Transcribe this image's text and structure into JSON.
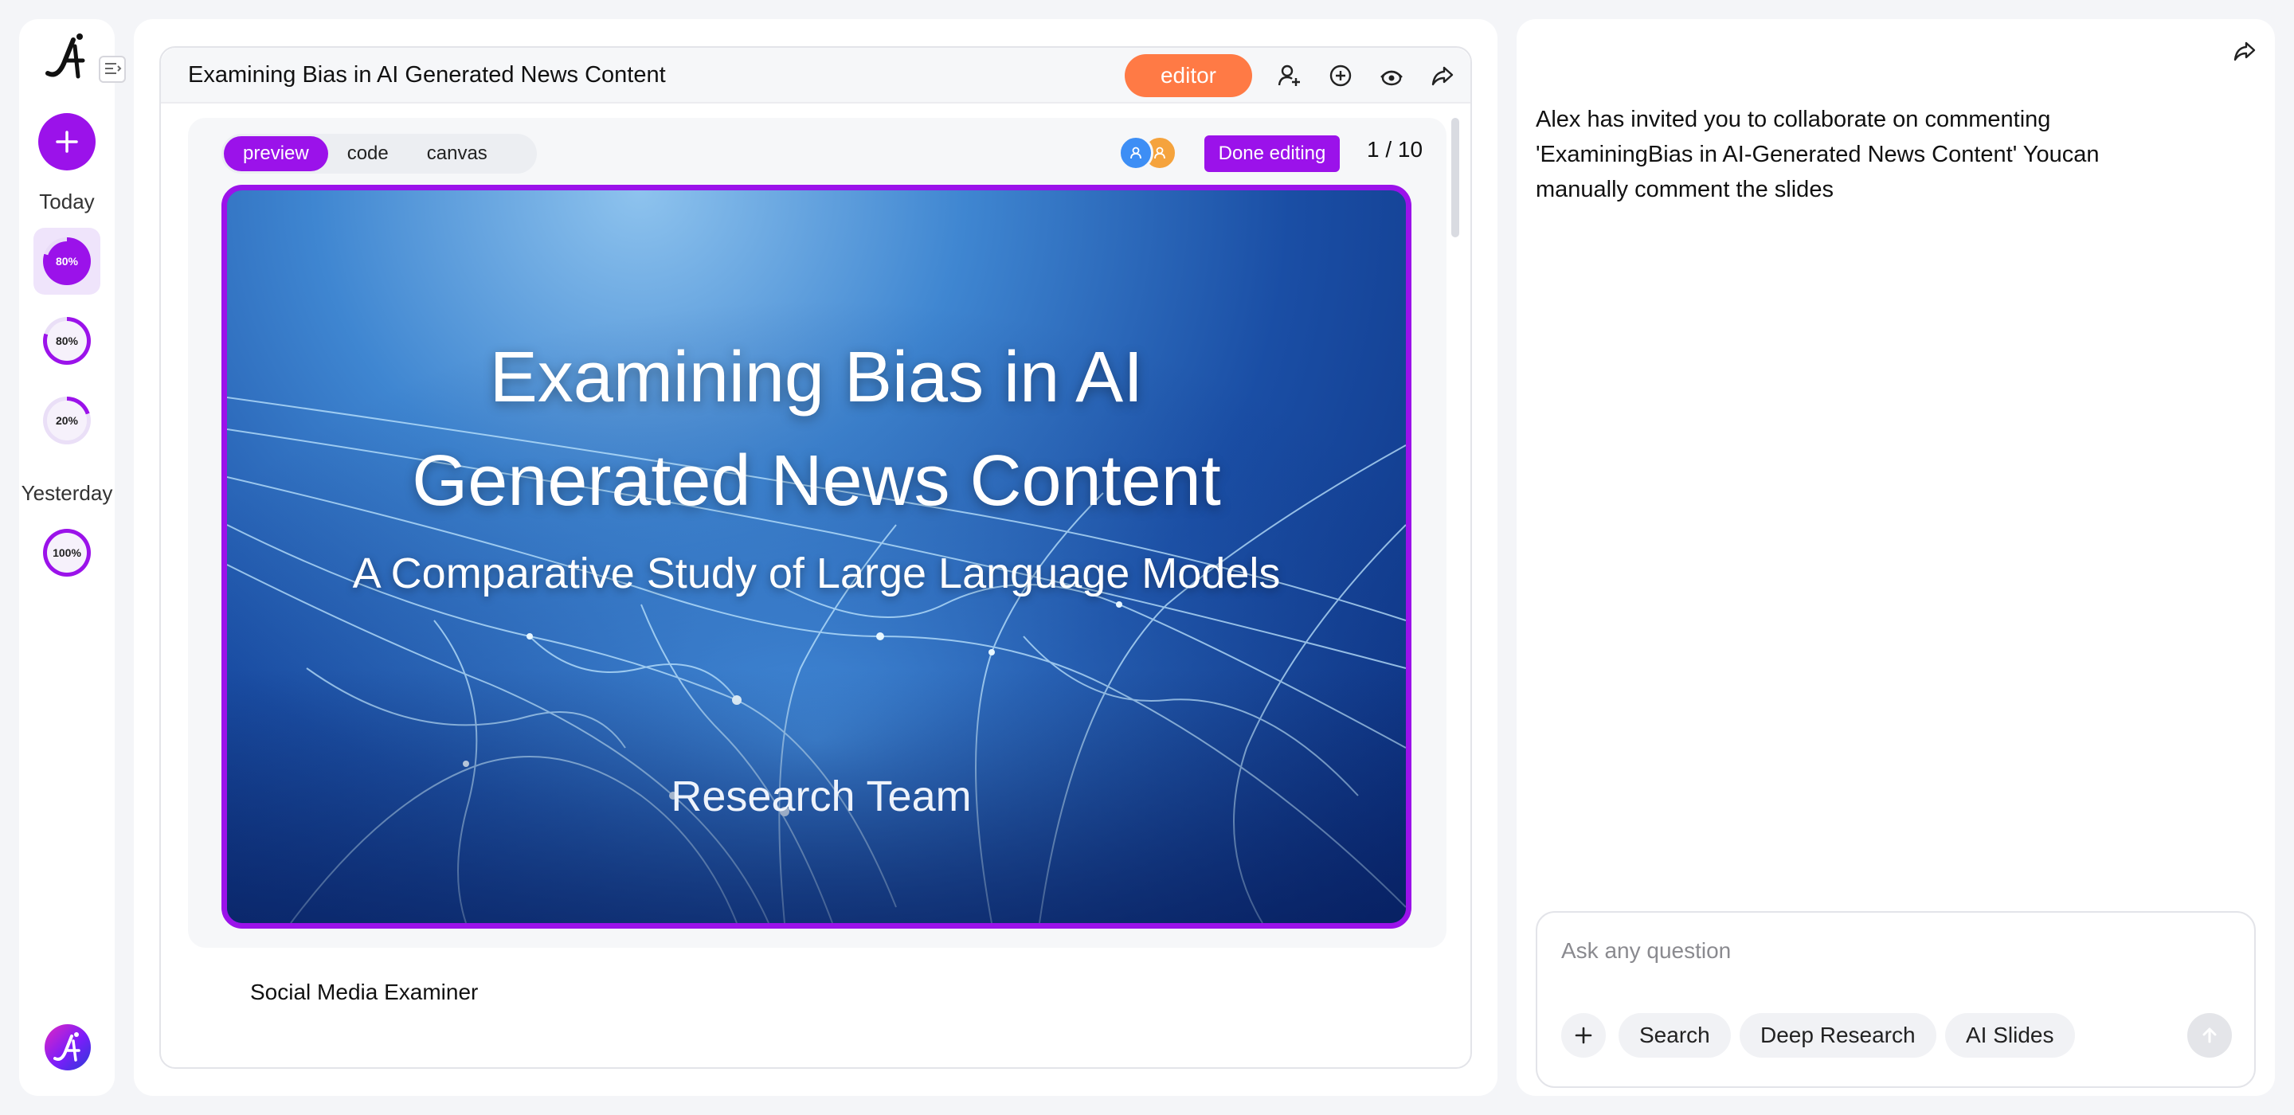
{
  "sidebar": {
    "groups": [
      {
        "label": "Today"
      },
      {
        "label": "Yesterday"
      }
    ],
    "items": [
      {
        "progress": "80%",
        "value": 0.8,
        "group": "Today",
        "active": true
      },
      {
        "progress": "80%",
        "value": 0.8,
        "group": "Today",
        "active": false
      },
      {
        "progress": "20%",
        "value": 0.2,
        "group": "Today",
        "active": false
      },
      {
        "progress": "100%",
        "value": 1.0,
        "group": "Yesterday",
        "active": false
      }
    ]
  },
  "document": {
    "title": "Examining Bias in AI Generated News Content",
    "editor_label": "editor",
    "tabs": [
      "preview",
      "code",
      "canvas"
    ],
    "active_tab": "preview",
    "done_label": "Done editing",
    "page_indicator": "1 / 10",
    "source_label": "Social Media Examiner"
  },
  "slide": {
    "title_line1": "Examining Bias in AI",
    "title_line2": "Generated News Content",
    "subtitle": "A Comparative Study of Large Language Models",
    "author": "Research Team"
  },
  "chat": {
    "message": "Alex has invited you to collaborate on commenting 'ExaminingBias in AI-Generated News Content' Youcan manually comment the slides",
    "placeholder": "Ask any question",
    "chips": [
      "Search",
      "Deep Research",
      "AI Slides"
    ]
  },
  "colors": {
    "accent": "#9b12ea",
    "editor": "#ff7a45",
    "avatar_blue": "#3d8ef5",
    "avatar_orange": "#f5a33d"
  },
  "icons": [
    "logo-icon",
    "collapse-sidebar-icon",
    "plus-icon",
    "add-user-icon",
    "add-circle-icon",
    "eye-icon",
    "share-icon",
    "user-icon",
    "send-arrow-icon",
    "brand-logo-icon"
  ]
}
